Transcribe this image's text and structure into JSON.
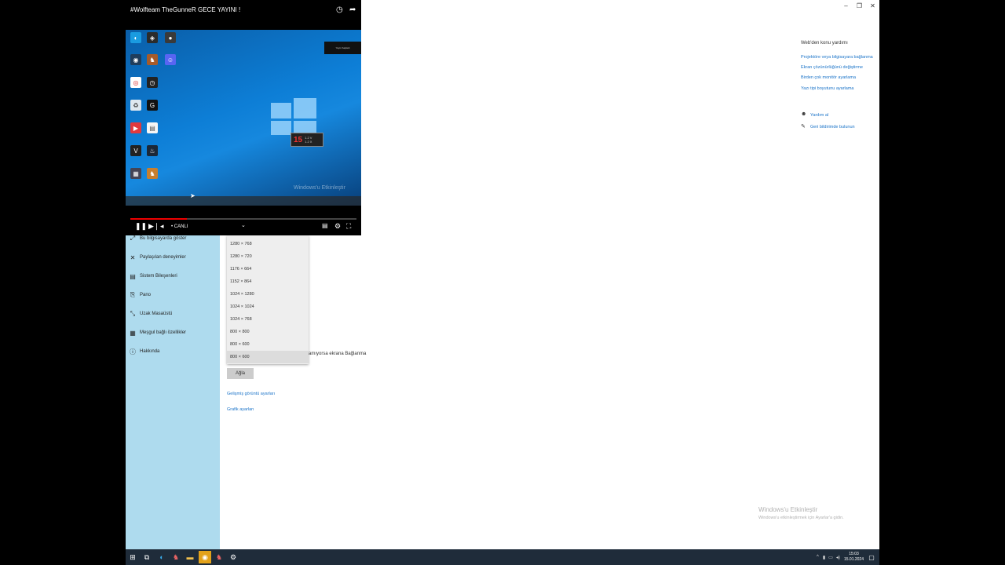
{
  "window": {
    "controls": [
      "–",
      "❐",
      "✕"
    ]
  },
  "sidebar": {
    "items": [
      {
        "label": "Bu bilgisayarda göster",
        "icon": "project-icon"
      },
      {
        "label": "Paylaşılan deneyimler",
        "icon": "shared-experiences-icon"
      },
      {
        "label": "Sistem Bileşenleri",
        "icon": "system-components-icon"
      },
      {
        "label": "Pano",
        "icon": "clipboard-icon"
      },
      {
        "label": "Uzak Masaüstü",
        "icon": "remote-desktop-icon"
      },
      {
        "label": "Meşgul bağlı özellikler",
        "icon": "optional-features-icon"
      },
      {
        "label": "Hakkında",
        "icon": "about-icon"
      }
    ]
  },
  "resolution_dropdown": {
    "options": [
      "1280 × 768",
      "1280 × 720",
      "1176 × 664",
      "1152 × 864",
      "1024 × 1280",
      "1024 × 1024",
      "1024 × 768",
      "800 × 800",
      "800 × 600",
      "800 × 600"
    ],
    "selected_index": 9
  },
  "main": {
    "partial_text": "amıyorsa ekrana Bağlanma",
    "apply_label": "Ağla",
    "links": [
      "Gelişmiş görüntü ayarları",
      "Grafik ayarları"
    ]
  },
  "help": {
    "heading": "Web'den konu yardımı",
    "links": [
      "Projektöre veya bilgisayara bağlanma",
      "Ekran çözünürlüğünü değiştirme",
      "Birden çok monitör ayarlama",
      "Yazı tipi boyutunu ayarlama"
    ],
    "support_links": [
      {
        "label": "Yardım al",
        "icon": "help-icon"
      },
      {
        "label": "Geri bildirimde bulunun",
        "icon": "feedback-icon"
      }
    ]
  },
  "watermark": {
    "title": "Windows'u Etkinleştir",
    "subtitle": "Windows'u etkinleştirmek için Ayarlar'a gidin."
  },
  "taskbar": {
    "clock_time": "15:03",
    "clock_date": "15.01.2024"
  },
  "video": {
    "title": "#Wolfteam TheGunneR GECE YAYINI !",
    "live_label": "• CANLI",
    "progress": 0.25,
    "buffered": 0.25,
    "desktop_watermark": "Windows'u Etkinleştir",
    "notification": "Yayın başladı",
    "fps_value": "15",
    "fps_details": "1.2 V\n1.2 X"
  }
}
